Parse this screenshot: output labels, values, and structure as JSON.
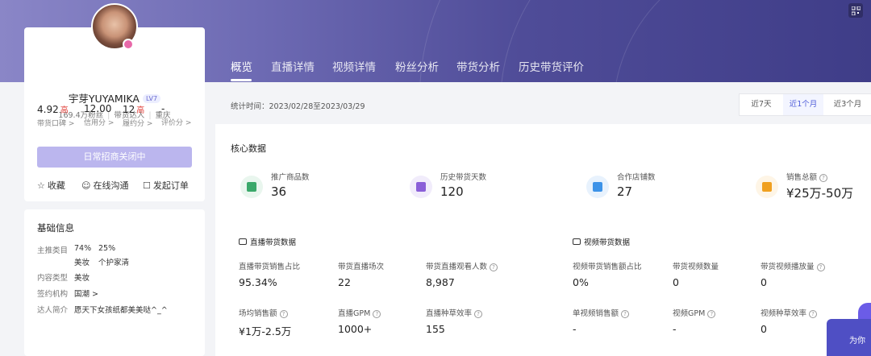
{
  "header": {
    "qr_icon": "qr-code-icon"
  },
  "profile": {
    "name": "宇芽YUYAMIKA",
    "level_badge": "LV7",
    "fans": "169.4万粉丝",
    "role": "带货达人",
    "city": "重庆",
    "scores": [
      {
        "value": "4.92",
        "tag": "高",
        "label": "带货口碑 >"
      },
      {
        "value": "12.00",
        "tag": "",
        "label": "信用分 >"
      },
      {
        "value": "12",
        "tag": "高",
        "label": "履约分 >"
      },
      {
        "value": "-",
        "tag": "",
        "label": "评价分 >"
      }
    ],
    "cta": "日常招商关闭中",
    "actions": [
      {
        "icon": "star-icon",
        "label": "收藏"
      },
      {
        "icon": "chat-icon",
        "label": "在线沟通"
      },
      {
        "icon": "order-icon",
        "label": "发起订单"
      }
    ]
  },
  "basic_info": {
    "title": "基础信息",
    "main_category_label": "主推类目",
    "main_category": [
      {
        "pct": "74%",
        "name": "美妆"
      },
      {
        "pct": "25%",
        "name": "个护家清"
      }
    ],
    "content_type_label": "内容类型",
    "content_type": "美妆",
    "agency_label": "签约机构",
    "agency": "国潮 >",
    "intro_label": "达人简介",
    "intro": "愿天下女孩纸都美美哒^_^"
  },
  "tabs": [
    "概览",
    "直播详情",
    "视频详情",
    "粉丝分析",
    "带货分析",
    "历史带货评价"
  ],
  "stats_period": "统计时间：2023/02/28至2023/03/29",
  "range_options": [
    "近7天",
    "近1个月",
    "近3个月"
  ],
  "core": {
    "title": "核心数据",
    "kpis": [
      {
        "label": "推广商品数",
        "value": "36",
        "help": false,
        "color": "#3aa86a",
        "bg": "#e9f6ee"
      },
      {
        "label": "历史带货天数",
        "value": "120",
        "help": false,
        "color": "#8a5fd8",
        "bg": "#f1ecfb"
      },
      {
        "label": "合作店铺数",
        "value": "27",
        "help": false,
        "color": "#3d93e8",
        "bg": "#e8f2fd"
      },
      {
        "label": "销售总额",
        "value": "¥25万-50万",
        "help": true,
        "color": "#f0a020",
        "bg": "#fef5e6"
      }
    ]
  },
  "live": {
    "title": "直播带货数据",
    "metrics": [
      {
        "label": "直播带货销售占比",
        "value": "95.34%",
        "help": false
      },
      {
        "label": "带货直播场次",
        "value": "22",
        "help": false
      },
      {
        "label": "带货直播观看人数",
        "value": "8,987",
        "help": true
      },
      {
        "label": "场均销售额",
        "value": "¥1万-2.5万",
        "help": true
      },
      {
        "label": "直播GPM",
        "value": "1000+",
        "help": true
      },
      {
        "label": "直播种草效率",
        "value": "155",
        "help": true
      }
    ]
  },
  "video": {
    "title": "视频带货数据",
    "metrics": [
      {
        "label": "视频带货销售额占比",
        "value": "0%",
        "help": false
      },
      {
        "label": "带货视频数量",
        "value": "0",
        "help": false
      },
      {
        "label": "带货视频播放量",
        "value": "0",
        "help": true
      },
      {
        "label": "单视频销售额",
        "value": "-",
        "help": true
      },
      {
        "label": "视频GPM",
        "value": "-",
        "help": true
      },
      {
        "label": "视频种草效率",
        "value": "0",
        "help": true
      }
    ]
  },
  "float_widget": "为你"
}
